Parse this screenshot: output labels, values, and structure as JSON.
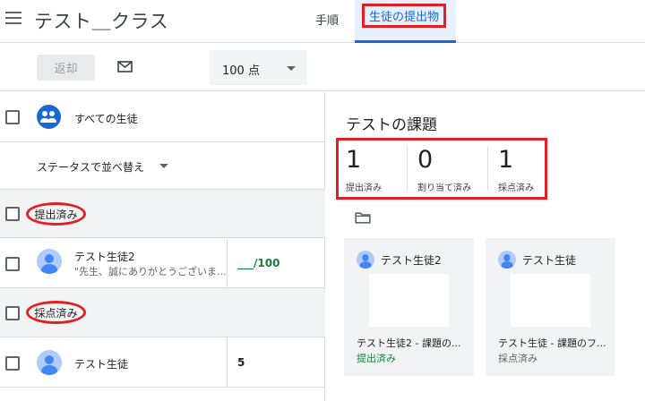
{
  "header": {
    "class_title": "テスト＿クラス",
    "tabs": [
      {
        "label": "手順"
      },
      {
        "label": "生徒の提出物"
      }
    ]
  },
  "toolbar": {
    "return_label": "返却",
    "points_value": "100 点"
  },
  "students_panel": {
    "all_students_label": "すべての生徒",
    "sort_label": "ステータスで並べ替え",
    "groups": [
      {
        "title": "提出済み",
        "students": [
          {
            "name": "テスト生徒2",
            "comment": "\"先生、誠にありがとうございま...",
            "score": "___/100"
          }
        ]
      },
      {
        "title": "採点済み",
        "students": [
          {
            "name": "テスト生徒",
            "comment": "",
            "score": "5"
          }
        ]
      }
    ]
  },
  "assignment_panel": {
    "title": "テストの課題",
    "stats": [
      {
        "number": "1",
        "label": "提出済み"
      },
      {
        "number": "0",
        "label": "割り当て済み"
      },
      {
        "number": "1",
        "label": "採点済み"
      }
    ],
    "cards": [
      {
        "student": "テスト生徒2",
        "file": "テスト生徒2 - 課題の...",
        "status": "提出済み",
        "status_color": "#188038"
      },
      {
        "student": "テスト生徒",
        "file": "テスト生徒 - 課題のフ...",
        "status": "採点済み",
        "status_color": "#5f6368"
      }
    ]
  },
  "colors": {
    "accent": "#1967d2",
    "highlight": "#e31e25",
    "turned_in": "#188038"
  }
}
